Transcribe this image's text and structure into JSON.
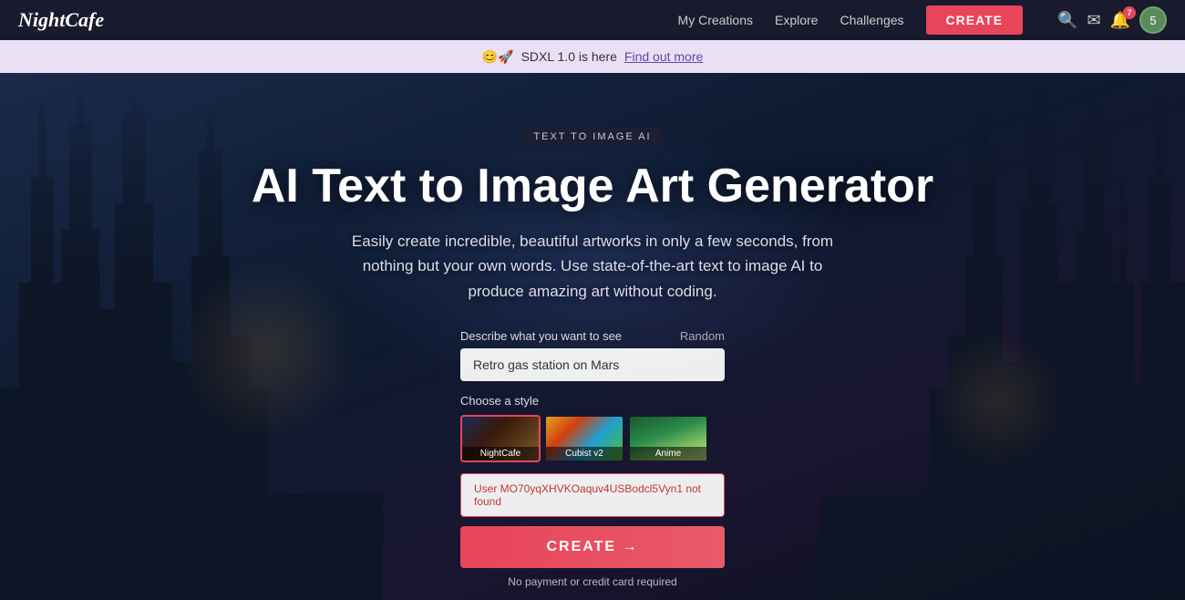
{
  "navbar": {
    "logo": "NightCafe",
    "links": [
      {
        "id": "my-creations",
        "label": "My Creations"
      },
      {
        "id": "explore",
        "label": "Explore"
      },
      {
        "id": "challenges",
        "label": "Challenges"
      }
    ],
    "create_button_label": "CREATE",
    "notification_badge": "7",
    "avatar_badge": "5"
  },
  "announcement": {
    "emoji": "😊🚀",
    "text": "SDXL 1.0 is here",
    "link_text": "Find out more"
  },
  "hero": {
    "badge": "TEXT TO IMAGE AI",
    "title": "AI Text to Image Art Generator",
    "subtitle": "Easily create incredible, beautiful artworks in only a few seconds, from nothing but your own words. Use state-of-the-art text to image AI to produce amazing art without coding.",
    "prompt_label": "Describe what you want to see",
    "prompt_value": "Retro gas station on Mars",
    "random_label": "Random",
    "style_label": "Choose a style",
    "styles": [
      {
        "id": "nightcafe",
        "label": "NightCafe",
        "selected": true
      },
      {
        "id": "cubist",
        "label": "Cubist v2",
        "selected": false
      },
      {
        "id": "anime",
        "label": "Anime",
        "selected": false
      }
    ],
    "error_text": "User MO70yqXHVKOaquv4USBodcl5Vyn1 not found",
    "create_button_label": "CREATE →",
    "no_payment_text": "No payment or credit card required"
  }
}
